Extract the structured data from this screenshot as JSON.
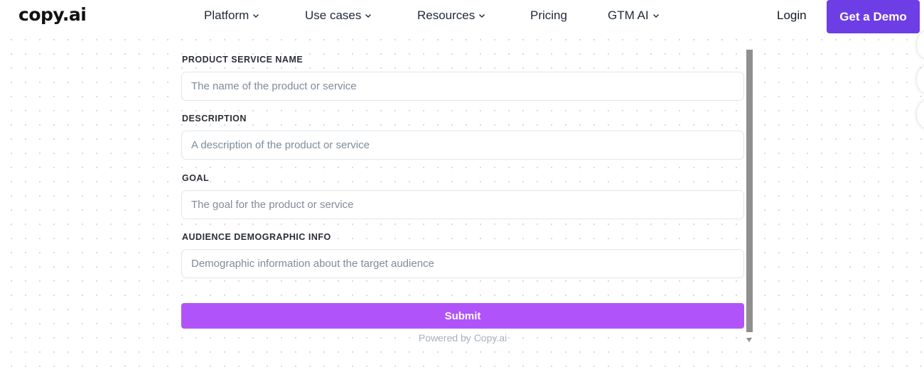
{
  "header": {
    "logo": "copy.ai",
    "nav": [
      {
        "label": "Platform",
        "has_dropdown": true
      },
      {
        "label": "Use cases",
        "has_dropdown": true
      },
      {
        "label": "Resources",
        "has_dropdown": true
      },
      {
        "label": "Pricing",
        "has_dropdown": false
      },
      {
        "label": "GTM AI",
        "has_dropdown": true
      }
    ],
    "login_label": "Login",
    "demo_label": "Get a Demo"
  },
  "form": {
    "fields": [
      {
        "label": "PRODUCT SERVICE NAME",
        "placeholder": "The name of the product or service",
        "value": ""
      },
      {
        "label": "DESCRIPTION",
        "placeholder": "A description of the product or service",
        "value": ""
      },
      {
        "label": "GOAL",
        "placeholder": "The goal for the product or service",
        "value": ""
      },
      {
        "label": "AUDIENCE DEMOGRAPHIC INFO",
        "placeholder": "Demographic information about the target audience",
        "value": ""
      }
    ],
    "submit_label": "Submit",
    "powered_by": "Powered by Copy.ai"
  },
  "colors": {
    "brand": "#6d3de6",
    "submit": "#b054fa",
    "placeholder": "#7f8c99"
  },
  "icons": {
    "dropdown": "chevron-down-icon",
    "scroll_down": "scroll-down-arrow-icon"
  }
}
